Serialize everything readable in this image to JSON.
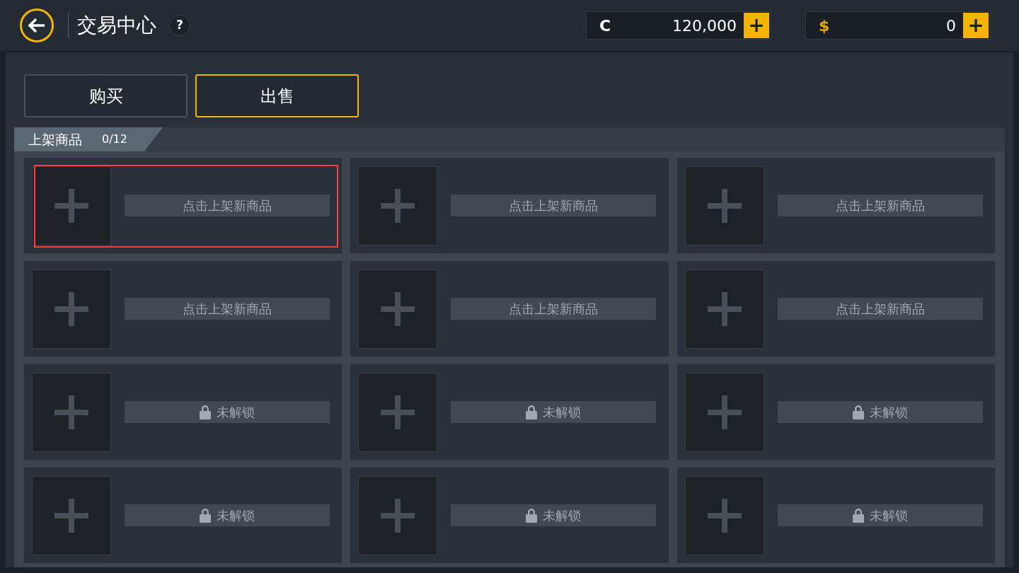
{
  "header": {
    "title": "交易中心",
    "help": "?",
    "currencies": [
      {
        "symbol": "C",
        "kind": "coin",
        "amount": "120,000",
        "add": "+"
      },
      {
        "symbol": "$",
        "kind": "dollar",
        "amount": "0",
        "add": "+"
      }
    ]
  },
  "tabs": [
    {
      "label": "购买",
      "selected": false
    },
    {
      "label": "出售",
      "selected": true
    }
  ],
  "section": {
    "title": "上架商品",
    "count": "0/12"
  },
  "slots": [
    {
      "label": "点击上架新商品",
      "locked": false,
      "selected": true
    },
    {
      "label": "点击上架新商品",
      "locked": false,
      "selected": false
    },
    {
      "label": "点击上架新商品",
      "locked": false,
      "selected": false
    },
    {
      "label": "点击上架新商品",
      "locked": false,
      "selected": false
    },
    {
      "label": "点击上架新商品",
      "locked": false,
      "selected": false
    },
    {
      "label": "点击上架新商品",
      "locked": false,
      "selected": false
    },
    {
      "label": "未解锁",
      "locked": true,
      "selected": false
    },
    {
      "label": "未解锁",
      "locked": true,
      "selected": false
    },
    {
      "label": "未解锁",
      "locked": true,
      "selected": false
    },
    {
      "label": "未解锁",
      "locked": true,
      "selected": false
    },
    {
      "label": "未解锁",
      "locked": true,
      "selected": false
    },
    {
      "label": "未解锁",
      "locked": true,
      "selected": false
    }
  ]
}
